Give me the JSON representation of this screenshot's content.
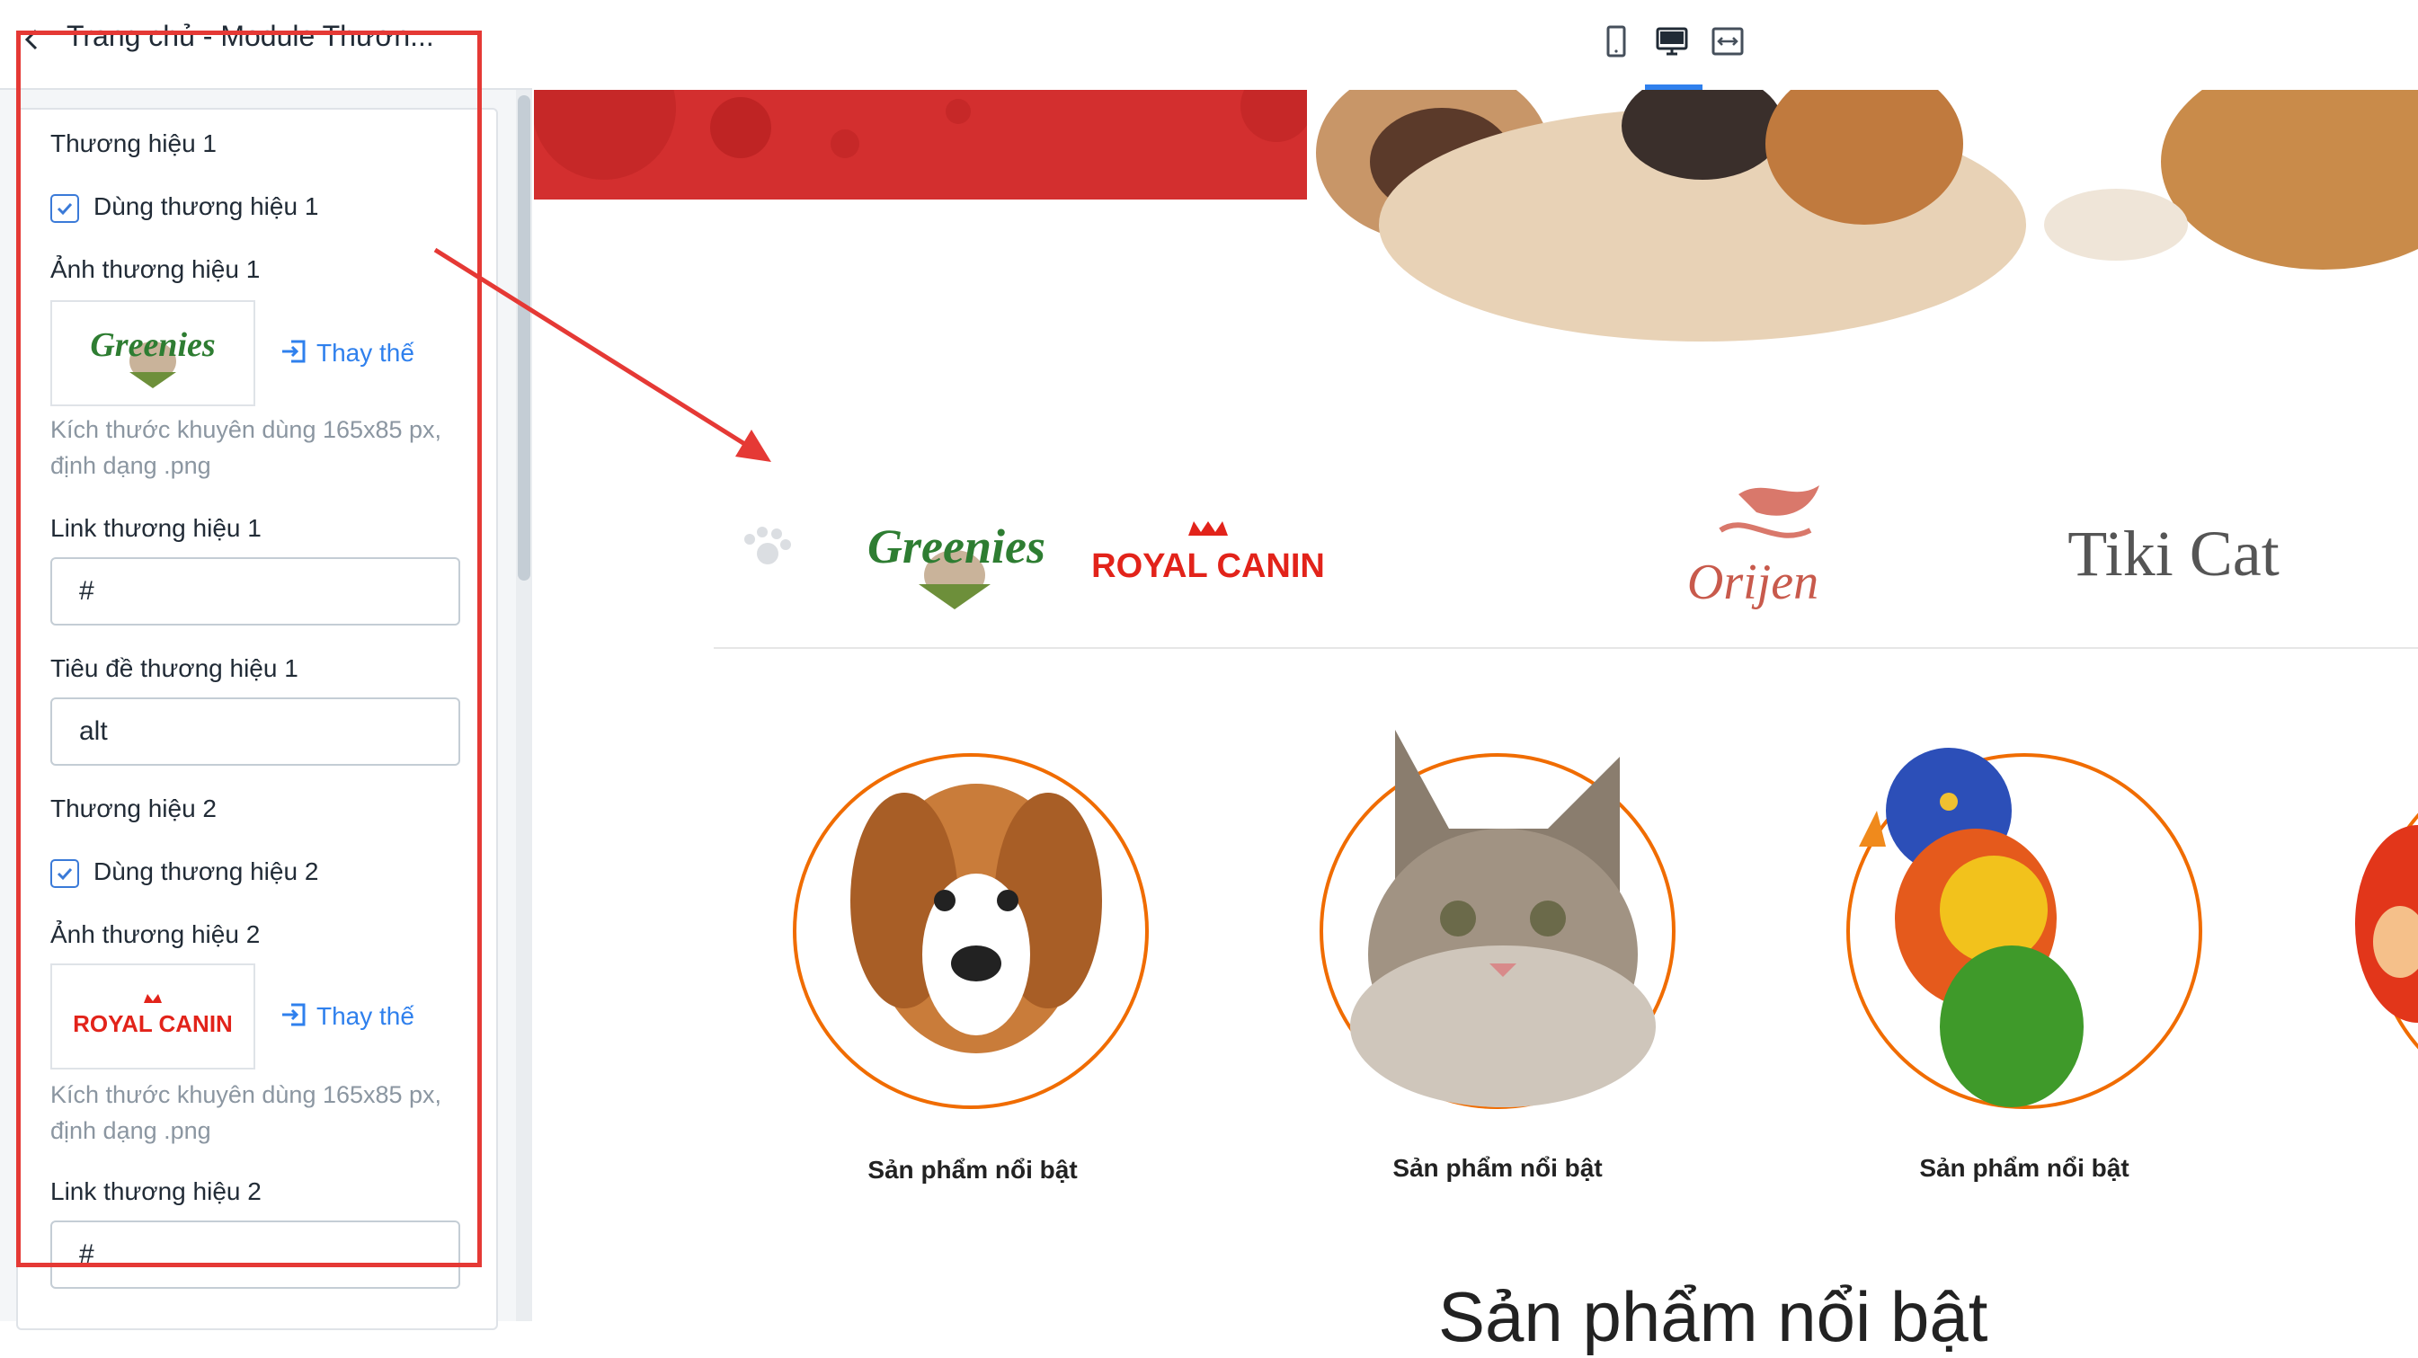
{
  "sidebar": {
    "title": "Trang chủ - Module Thươn...",
    "brand1": {
      "section_label": "Thương hiệu 1",
      "enable_label": "Dùng thương hiệu 1",
      "enabled": true,
      "image_label": "Ảnh thương hiệu 1",
      "image_text": "Greenies",
      "replace_label": "Thay thế",
      "hint": "Kích thước khuyên dùng 165x85 px, định dạng .png",
      "link_label": "Link thương hiệu 1",
      "link_value": "#",
      "title_label": "Tiêu đề thương hiệu 1",
      "title_value": "alt"
    },
    "brand2": {
      "section_label": "Thương hiệu 2",
      "enable_label": "Dùng thương hiệu 2",
      "enabled": true,
      "image_label": "Ảnh thương hiệu 2",
      "image_text": "ROYAL CANIN",
      "replace_label": "Thay thế",
      "hint": "Kích thước khuyên dùng 165x85 px, định dạng .png",
      "link_label": "Link thương hiệu 2",
      "link_value": "#"
    }
  },
  "toolbar": {
    "devices": [
      "mobile-icon",
      "desktop-icon",
      "fullwidth-icon"
    ],
    "active_device": "desktop"
  },
  "preview": {
    "brands": [
      "Greenies",
      "ROYAL CANIN",
      "Orijen",
      "Tiki Cat"
    ],
    "categories": [
      {
        "label": "Sản phẩm nổi bật",
        "image": "dog"
      },
      {
        "label": "Sản phẩm nổi bật",
        "image": "cat"
      },
      {
        "label": "Sản phẩm nổi bật",
        "image": "parrot"
      }
    ],
    "section_heading": "Sản phẩm nổi bật"
  },
  "colors": {
    "accent": "#2f80ed",
    "hero_red": "#d32f2f",
    "circle_orange": "#f06c00",
    "annotation_red": "#e53935",
    "royal_canin_red": "#e2231a",
    "greenies_green": "#2e7d32"
  }
}
